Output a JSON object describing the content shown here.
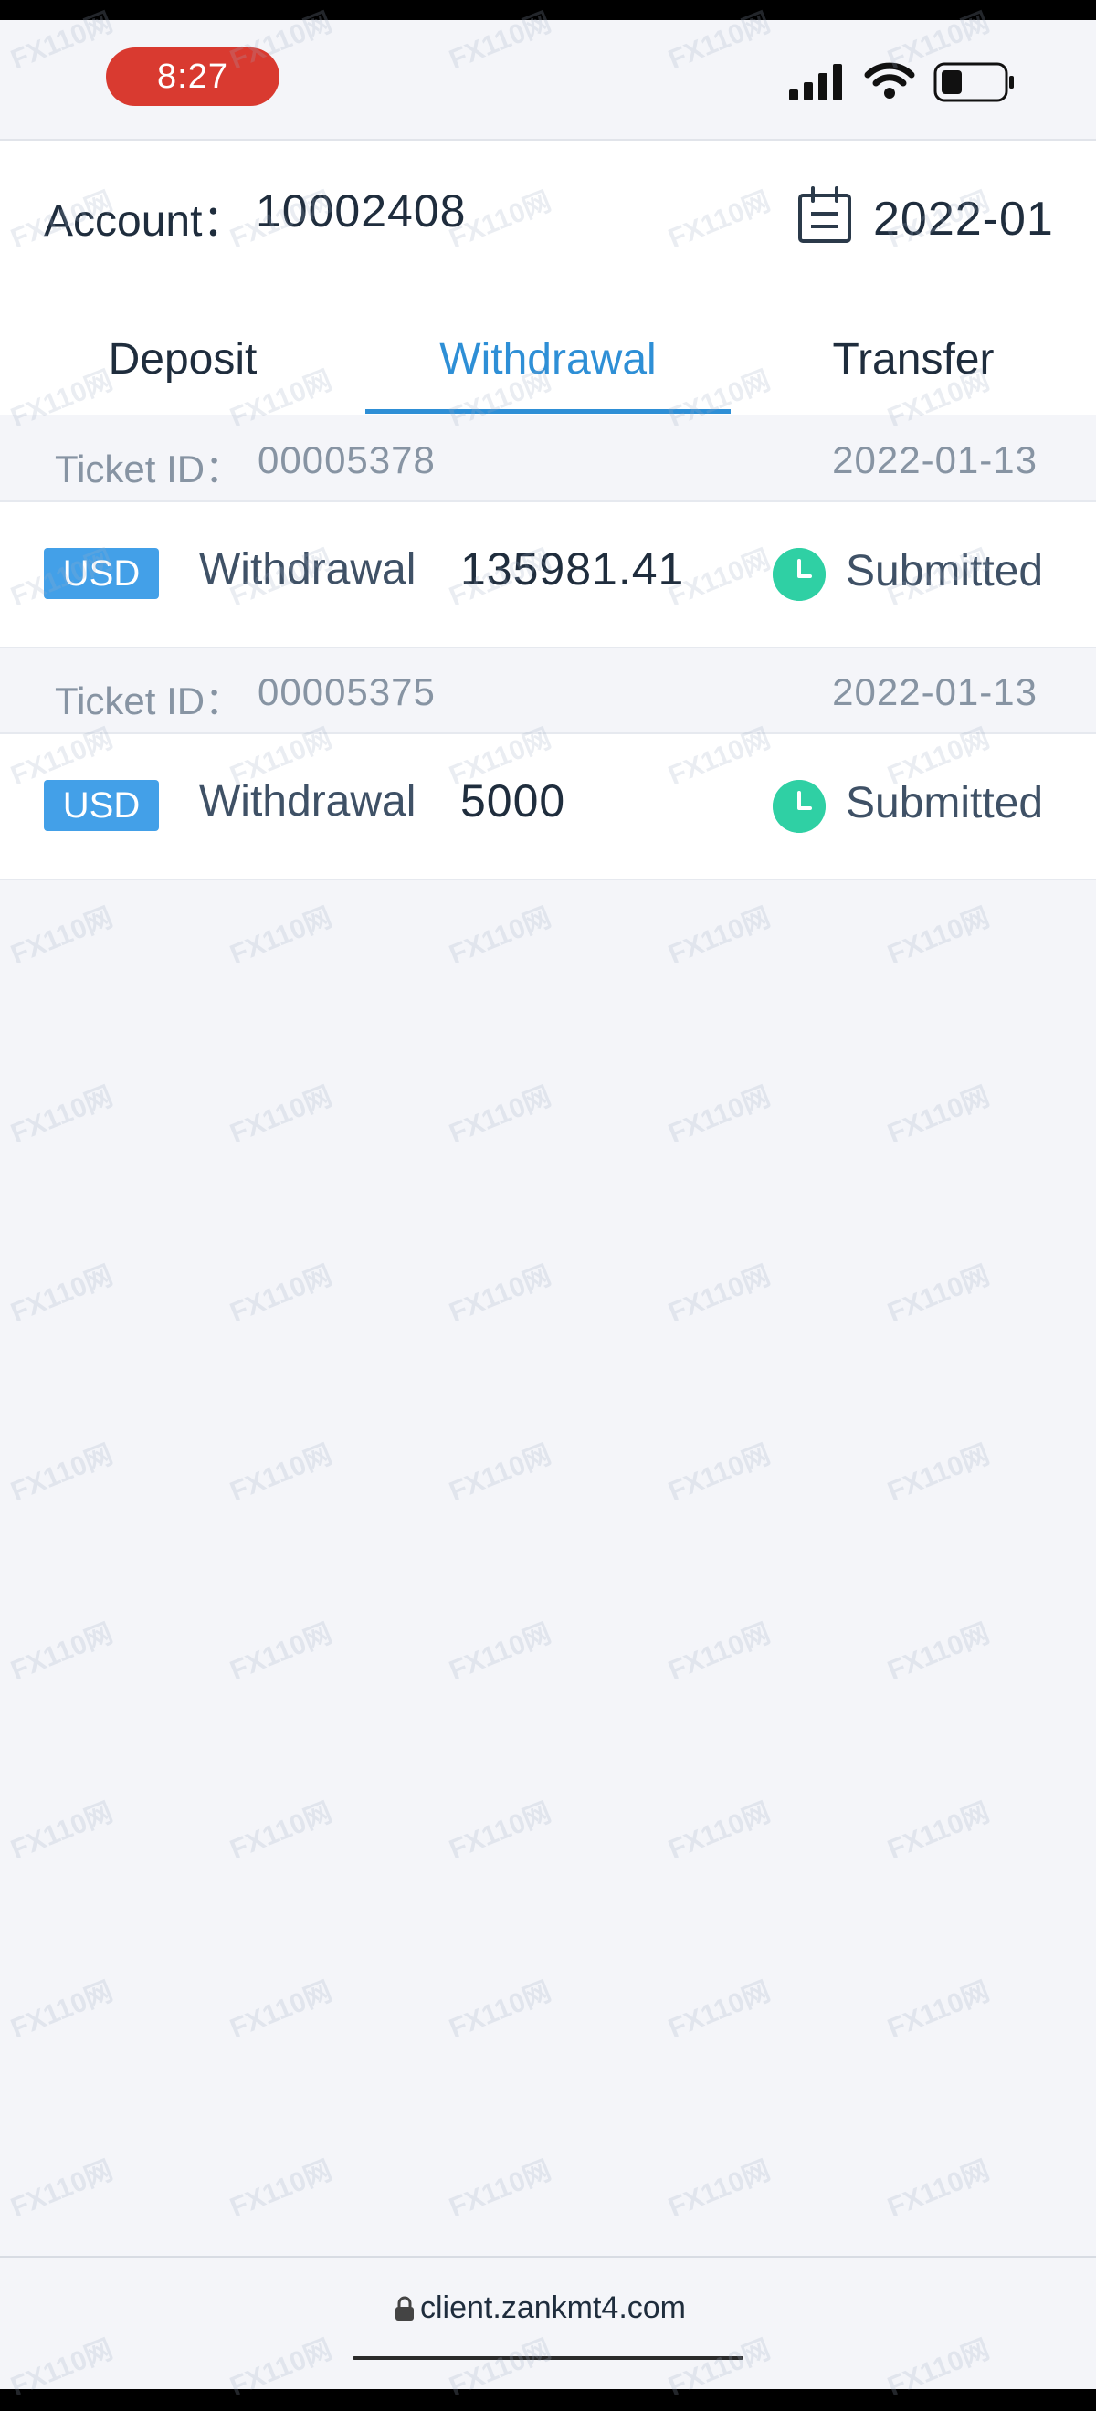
{
  "status_bar": {
    "time": "8:27"
  },
  "header": {
    "account_label": "Account：",
    "account_number": "10002408",
    "month": "2022-01"
  },
  "tabs": [
    {
      "label": "Deposit",
      "active": false
    },
    {
      "label": "Withdrawal",
      "active": true
    },
    {
      "label": "Transfer",
      "active": false
    }
  ],
  "tickets": [
    {
      "ticket_label": "Ticket ID：",
      "ticket_id": "00005378",
      "date": "2022-01-13",
      "currency": "USD",
      "type": "Withdrawal",
      "amount": "135981.41",
      "status": "Submitted"
    },
    {
      "ticket_label": "Ticket ID：",
      "ticket_id": "00005375",
      "date": "2022-01-13",
      "currency": "USD",
      "type": "Withdrawal",
      "amount": "5000",
      "status": "Submitted"
    }
  ],
  "browser": {
    "url": "client.zankmt4.com"
  },
  "watermark": {
    "text": "FX110网"
  },
  "colors": {
    "accent": "#2e8fd6",
    "badge": "#43a0e8",
    "status_ok": "#2fd0a4",
    "time_pill": "#d93a30"
  },
  "icons": [
    "signal-icon",
    "wifi-icon",
    "battery-icon",
    "calendar-icon",
    "clock-icon",
    "lock-icon"
  ]
}
